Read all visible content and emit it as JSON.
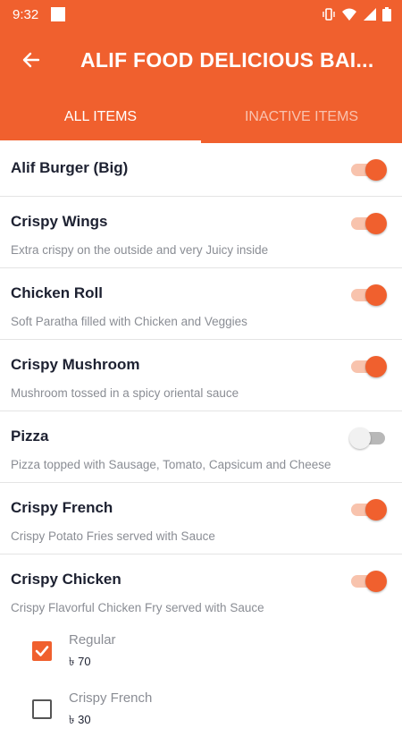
{
  "status": {
    "time": "9:32"
  },
  "header": {
    "title": "ALIF FOOD DELICIOUS BAI..."
  },
  "tabs": [
    {
      "label": "ALL ITEMS"
    },
    {
      "label": "INACTIVE ITEMS"
    }
  ],
  "items": [
    {
      "name": "Alif Burger (Big)",
      "desc": "",
      "active": true
    },
    {
      "name": "Crispy Wings",
      "desc": "Extra crispy on the outside and very Juicy inside",
      "active": true
    },
    {
      "name": "Chicken Roll",
      "desc": "Soft Paratha filled with Chicken and Veggies",
      "active": true
    },
    {
      "name": "Crispy Mushroom",
      "desc": "Mushroom tossed in a spicy oriental sauce",
      "active": true
    },
    {
      "name": "Pizza",
      "desc": "Pizza topped with Sausage, Tomato, Capsicum and Cheese",
      "active": false
    },
    {
      "name": "Crispy French",
      "desc": "Crispy Potato Fries served with Sauce",
      "active": true
    },
    {
      "name": "Crispy Chicken",
      "desc": "Crispy Flavorful Chicken Fry served with Sauce",
      "active": true
    }
  ],
  "variants": [
    {
      "name": "Regular",
      "price": "৳ 70",
      "checked": true
    },
    {
      "name": "Crispy French",
      "price": "৳ 30",
      "checked": false
    }
  ],
  "colors": {
    "accent": "#f0602e"
  }
}
